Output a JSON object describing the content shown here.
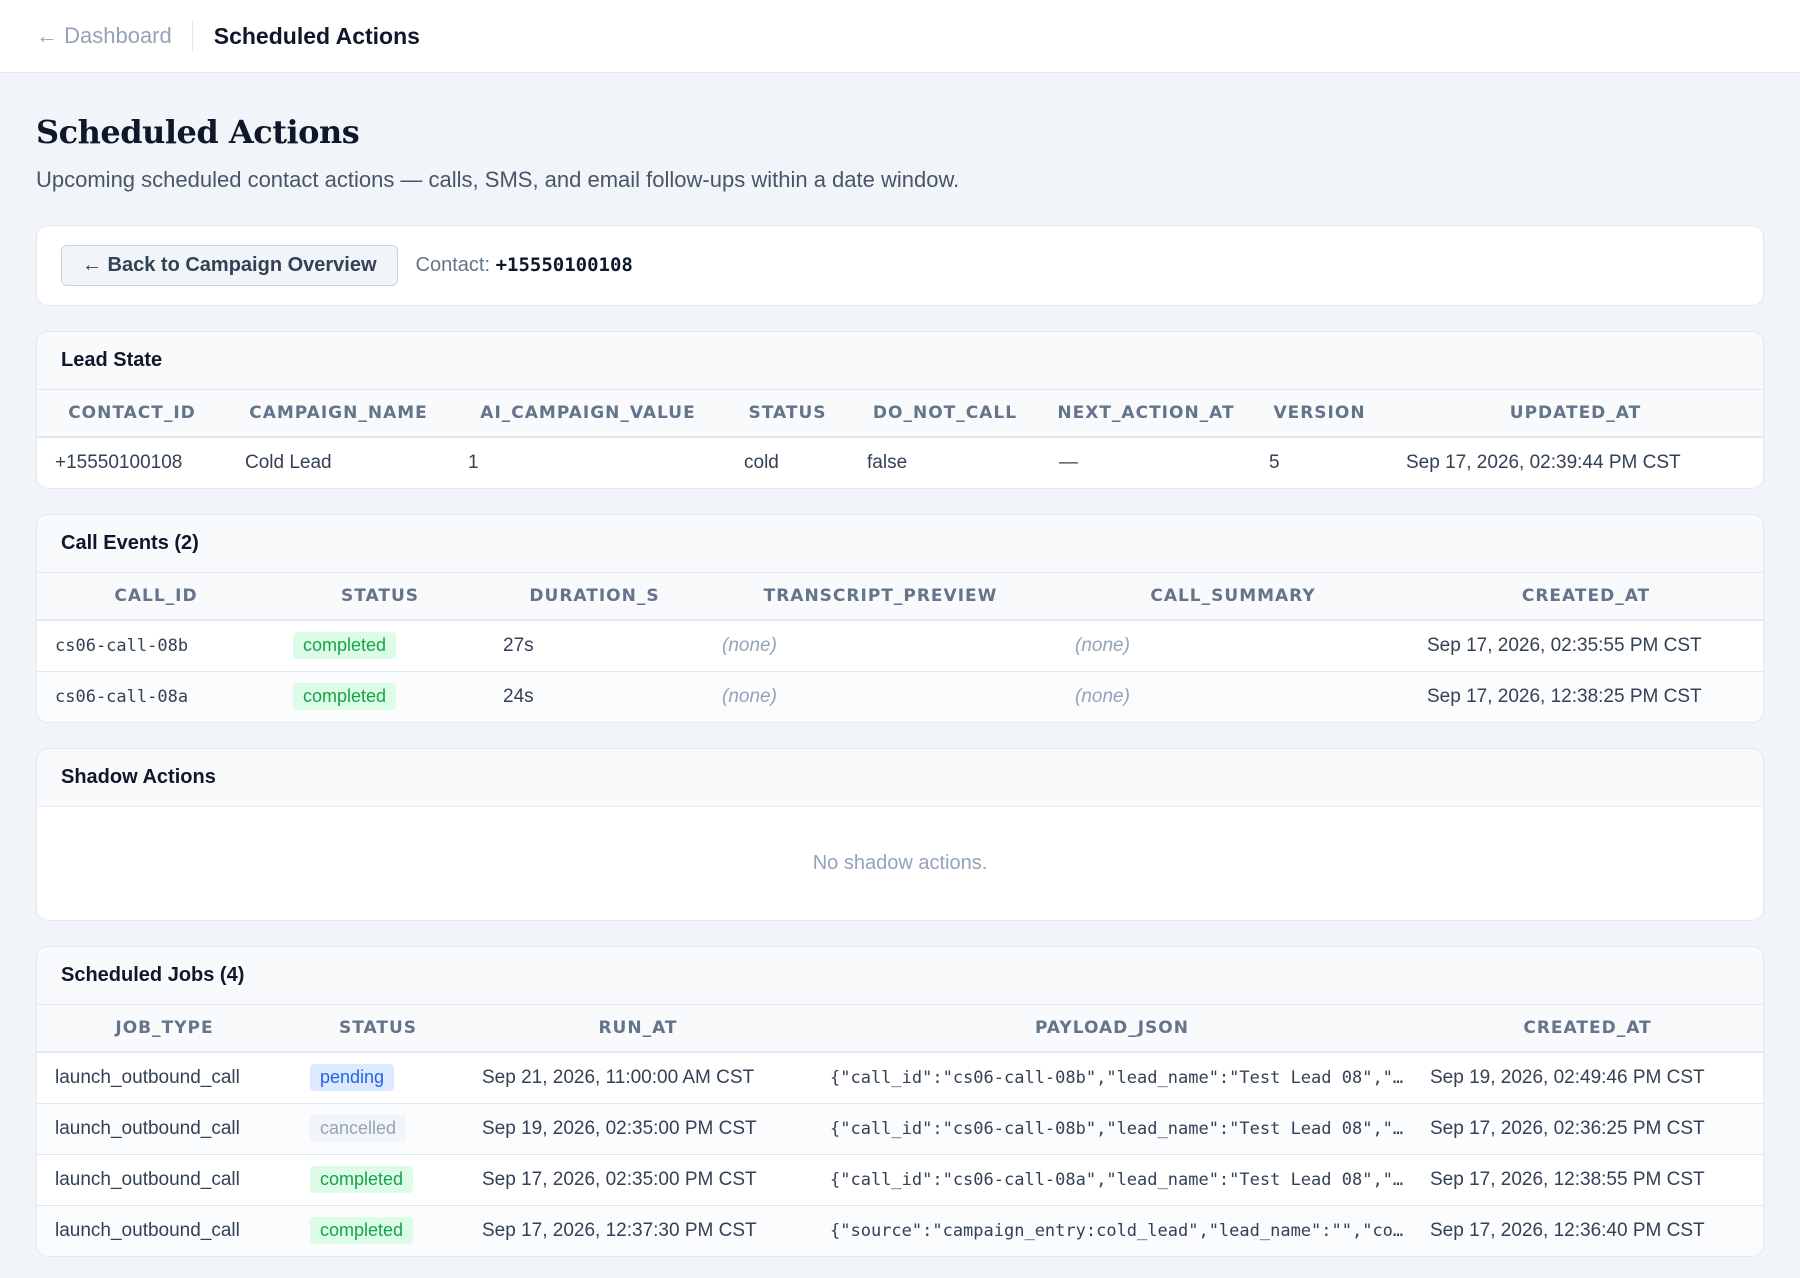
{
  "topbar": {
    "back_label": "← Dashboard",
    "crumb": "Scheduled Actions"
  },
  "header": {
    "title": "Scheduled Actions",
    "subtitle": "Upcoming scheduled contact actions — calls, SMS, and email follow-ups within a date window."
  },
  "toolbar": {
    "back_button": "← Back to Campaign Overview",
    "contact_label": "Contact:",
    "contact_value": "+15550100108"
  },
  "lead_state": {
    "title": "Lead State",
    "columns": [
      "CONTACT_ID",
      "CAMPAIGN_NAME",
      "AI_CAMPAIGN_VALUE",
      "STATUS",
      "DO_NOT_CALL",
      "NEXT_ACTION_AT",
      "VERSION",
      "UPDATED_AT"
    ],
    "row": {
      "contact_id": "+15550100108",
      "campaign_name": "Cold Lead",
      "ai_campaign_value": "1",
      "status": "cold",
      "do_not_call": "false",
      "next_action_at": "—",
      "version": "5",
      "updated_at": "Sep 17, 2026, 02:39:44 PM CST"
    }
  },
  "call_events": {
    "title": "Call Events (2)",
    "columns": [
      "CALL_ID",
      "STATUS",
      "DURATION_S",
      "TRANSCRIPT_PREVIEW",
      "CALL_SUMMARY",
      "CREATED_AT"
    ],
    "rows": [
      {
        "call_id": "cs06-call-08b",
        "status": "completed",
        "duration": "27s",
        "transcript": "(none)",
        "summary": "(none)",
        "created_at": "Sep 17, 2026, 02:35:55 PM CST"
      },
      {
        "call_id": "cs06-call-08a",
        "status": "completed",
        "duration": "24s",
        "transcript": "(none)",
        "summary": "(none)",
        "created_at": "Sep 17, 2026, 12:38:25 PM CST"
      }
    ]
  },
  "shadow_actions": {
    "title": "Shadow Actions",
    "empty": "No shadow actions."
  },
  "scheduled_jobs": {
    "title": "Scheduled Jobs (4)",
    "columns": [
      "JOB_TYPE",
      "STATUS",
      "RUN_AT",
      "PAYLOAD_JSON",
      "CREATED_AT"
    ],
    "rows": [
      {
        "job_type": "launch_outbound_call",
        "status": "pending",
        "run_at": "Sep 21, 2026, 11:00:00 AM CST",
        "payload": "{\"call_id\":\"cs06-call-08b\",\"lead_name\":\"Test Lead 08\",\"c...",
        "created_at": "Sep 19, 2026, 02:49:46 PM CST"
      },
      {
        "job_type": "launch_outbound_call",
        "status": "cancelled",
        "run_at": "Sep 19, 2026, 02:35:00 PM CST",
        "payload": "{\"call_id\":\"cs06-call-08b\",\"lead_name\":\"Test Lead 08\",\"c...",
        "created_at": "Sep 17, 2026, 02:36:25 PM CST"
      },
      {
        "job_type": "launch_outbound_call",
        "status": "completed",
        "run_at": "Sep 17, 2026, 02:35:00 PM CST",
        "payload": "{\"call_id\":\"cs06-call-08a\",\"lead_name\":\"Test Lead 08\",\"c...",
        "created_at": "Sep 17, 2026, 12:38:55 PM CST"
      },
      {
        "job_type": "launch_outbound_call",
        "status": "completed",
        "run_at": "Sep 17, 2026, 12:37:30 PM CST",
        "payload": "{\"source\":\"campaign_entry:cold_lead\",\"lead_name\":\"\",\"con...",
        "created_at": "Sep 17, 2026, 12:36:40 PM CST"
      }
    ]
  }
}
